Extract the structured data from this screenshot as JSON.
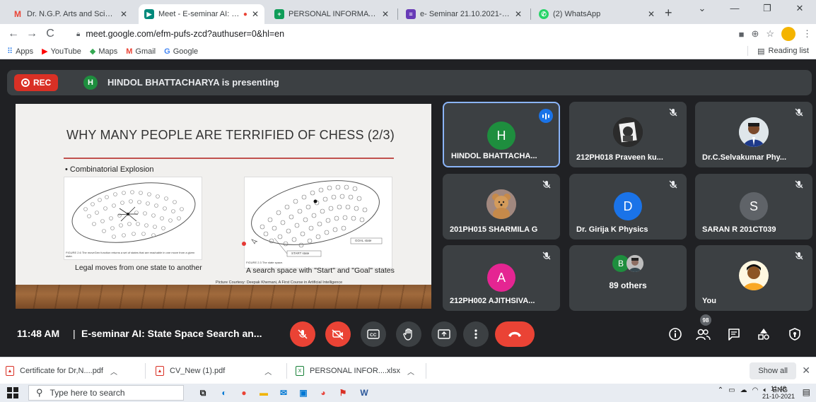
{
  "browser": {
    "tabs": [
      {
        "label": "Dr. N.G.P. Arts and Science C",
        "icon": "gmail-icon",
        "color": "#ea4335",
        "active": false
      },
      {
        "label": "Meet - E-seminar AI: Stat",
        "icon": "meet-icon",
        "color": "#00897b",
        "active": true
      },
      {
        "label": "PERSONAL INFORMATION -",
        "icon": "sheets-plus-icon",
        "color": "#0f9d58",
        "active": false
      },
      {
        "label": "e- Seminar 21.10.2021- Feed",
        "icon": "forms-icon",
        "color": "#673ab7",
        "active": false
      },
      {
        "label": "(2) WhatsApp",
        "icon": "whatsapp-icon",
        "color": "#25d366",
        "active": false
      }
    ],
    "new_tab": "+",
    "url": "meet.google.com/efm-pufs-zcd?authuser=0&hl=en",
    "bookmarks": [
      {
        "label": "Apps",
        "icon": "apps-grid-icon"
      },
      {
        "label": "YouTube",
        "icon": "youtube-icon"
      },
      {
        "label": "Maps",
        "icon": "maps-pin-icon"
      },
      {
        "label": "Gmail",
        "icon": "gmail-icon"
      },
      {
        "label": "Google",
        "icon": "google-icon"
      }
    ],
    "reading_list": "Reading list"
  },
  "meet": {
    "rec_label": "REC",
    "presenter_initial": "H",
    "presenting_text": "HINDOL BHATTACHARYA is presenting",
    "slide": {
      "title": "WHY MANY PEOPLE ARE TERRIFIED OF CHESS (2/3)",
      "bullet": "Combinatorial Explosion",
      "fig1_small": "FIGURE 2.6 The moveGen function returns a set of states that are reachable in one move from a given state.",
      "fig1_caption": "Legal moves from one state to another",
      "fig2_small": "FIGURE 2.3 The state space.",
      "fig2_start": "START state",
      "fig2_goal": "GOAL state",
      "fig2_caption": "A search space with \"Start\" and \"Goal\" states",
      "courtesy": "Picture Courtesy: Deepak Khemani, A First Course in Artificial Intelligence"
    },
    "participants": [
      {
        "name": "HINDOL BHATTACHA...",
        "initial": "H",
        "avatar_color": "#1e8e3e",
        "type": "letter",
        "speaking": true
      },
      {
        "name": "212PH018 Praveen ku...",
        "type": "photo",
        "photo": "dark-portrait",
        "muted": true
      },
      {
        "name": "Dr.C.Selvakumar Phy...",
        "type": "photo",
        "photo": "man-portrait",
        "muted": true
      },
      {
        "name": "201PH015 SHARMILA G",
        "type": "photo",
        "photo": "teddy-bear",
        "muted": true
      },
      {
        "name": "Dr. Girija K Physics",
        "initial": "D",
        "avatar_color": "#1a73e8",
        "type": "letter",
        "muted": true
      },
      {
        "name": "SARAN R 201CT039",
        "initial": "S",
        "avatar_color": "#5f6368",
        "type": "letter",
        "muted": true
      },
      {
        "name": "212PH002 AJITHSIVA...",
        "initial": "A",
        "avatar_color": "#e52592",
        "type": "letter",
        "muted": true
      },
      {
        "name": "89 others",
        "type": "others",
        "initial": "B"
      },
      {
        "name": "You",
        "type": "photo",
        "photo": "woman-portrait",
        "muted": true
      }
    ],
    "time": "11:48 AM",
    "separator": "|",
    "meeting_title": "E-seminar AI: State Space Search an...",
    "participant_count": "98"
  },
  "downloads": [
    {
      "name": "Certificate for Dr,N....pdf",
      "icon": "pdf-icon"
    },
    {
      "name": "CV_New (1).pdf",
      "icon": "pdf-icon"
    },
    {
      "name": "PERSONAL INFOR....xlsx",
      "icon": "excel-icon"
    }
  ],
  "show_all": "Show all",
  "taskbar": {
    "search_placeholder": "Type here to search",
    "tray_lang": "ENG",
    "clock_time": "11:48",
    "clock_date": "21-10-2021"
  }
}
